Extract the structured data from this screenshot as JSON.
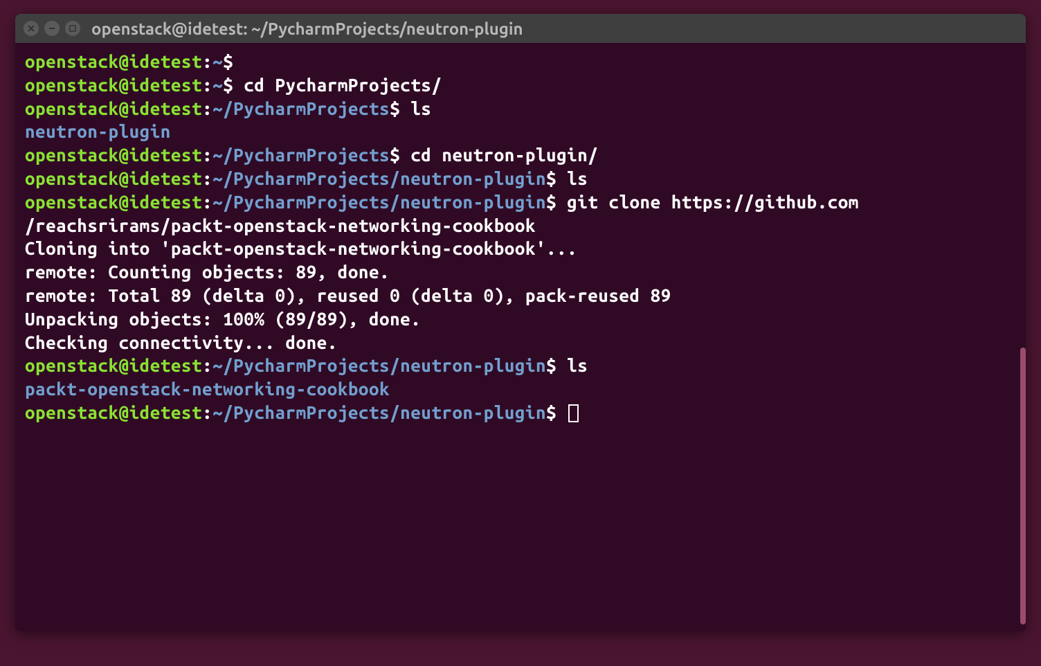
{
  "window": {
    "title": "openstack@idetest: ~/PycharmProjects/neutron-plugin"
  },
  "prompt": {
    "user_host": "openstack@idetest",
    "colon": ":",
    "dollar": "$"
  },
  "lines": [
    {
      "type": "prompt",
      "path": "~",
      "cmd": ""
    },
    {
      "type": "prompt",
      "path": "~",
      "cmd": "cd PycharmProjects/"
    },
    {
      "type": "prompt",
      "path": "~/PycharmProjects",
      "cmd": "ls"
    },
    {
      "type": "output-blue",
      "text": "neutron-plugin"
    },
    {
      "type": "prompt",
      "path": "~/PycharmProjects",
      "cmd": "cd neutron-plugin/"
    },
    {
      "type": "prompt",
      "path": "~/PycharmProjects/neutron-plugin",
      "cmd": "ls"
    },
    {
      "type": "prompt-wrap",
      "path": "~/PycharmProjects/neutron-plugin",
      "cmd_part1": "git clone https://github.com",
      "cmd_part2": "/reachsrirams/packt-openstack-networking-cookbook"
    },
    {
      "type": "output",
      "text": "Cloning into 'packt-openstack-networking-cookbook'..."
    },
    {
      "type": "output",
      "text": "remote: Counting objects: 89, done."
    },
    {
      "type": "output",
      "text": "remote: Total 89 (delta 0), reused 0 (delta 0), pack-reused 89"
    },
    {
      "type": "output",
      "text": "Unpacking objects: 100% (89/89), done."
    },
    {
      "type": "output",
      "text": "Checking connectivity... done."
    },
    {
      "type": "prompt",
      "path": "~/PycharmProjects/neutron-plugin",
      "cmd": "ls"
    },
    {
      "type": "output-blue",
      "text": "packt-openstack-networking-cookbook"
    },
    {
      "type": "prompt-cursor",
      "path": "~/PycharmProjects/neutron-plugin"
    }
  ]
}
